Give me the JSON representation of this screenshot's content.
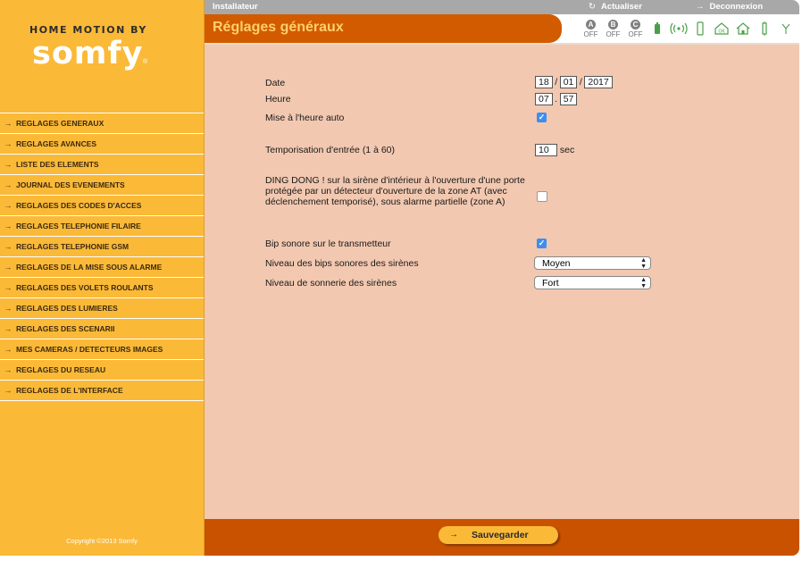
{
  "brand": {
    "tagline": "HOME MOTION BY",
    "name": "somfy",
    "mark": "®"
  },
  "sidebar": {
    "items": [
      {
        "label": "REGLAGES GENERAUX"
      },
      {
        "label": "REGLAGES AVANCES"
      },
      {
        "label": "LISTE DES ELEMENTS"
      },
      {
        "label": "JOURNAL DES EVENEMENTS"
      },
      {
        "label": "REGLAGES DES CODES D'ACCES"
      },
      {
        "label": "REGLAGES TELEPHONIE FILAIRE"
      },
      {
        "label": "REGLAGES TELEPHONIE GSM"
      },
      {
        "label": "REGLAGES DE LA MISE SOUS ALARME"
      },
      {
        "label": "REGLAGES DES VOLETS ROULANTS"
      },
      {
        "label": "REGLAGES DES LUMIERES"
      },
      {
        "label": "REGLAGES DES SCENARII"
      },
      {
        "label": "MES CAMERAS / DETECTEURS IMAGES"
      },
      {
        "label": "REGLAGES DU RESEAU"
      },
      {
        "label": "REGLAGES DE L'INTERFACE"
      }
    ],
    "copyright": "Copyright ©2013 Somfy"
  },
  "topbar": {
    "role": "Installateur",
    "refresh_label": "Actualiser",
    "logout_label": "Deconnexion"
  },
  "header": {
    "title": "Réglages généraux",
    "zones": [
      {
        "letter": "A",
        "state": "OFF"
      },
      {
        "letter": "B",
        "state": "OFF"
      },
      {
        "letter": "C",
        "state": "OFF"
      }
    ],
    "status_icons": [
      "battery-icon",
      "radio-signal-icon",
      "device-icon",
      "home-ok-icon",
      "house-icon",
      "sensor-icon",
      "antenna-icon"
    ],
    "accent_color": "#d25b00",
    "title_color": "#ffcf6a",
    "status_icon_color": "#4aa048"
  },
  "form": {
    "date": {
      "label": "Date",
      "day": "18",
      "month": "01",
      "year": "2017",
      "sep": "/"
    },
    "time": {
      "label": "Heure",
      "hours": "07",
      "minutes": "57",
      "sep": "."
    },
    "auto_time": {
      "label": "Mise à l'heure auto",
      "checked": true
    },
    "entry_delay": {
      "label": "Temporisation d'entrée (1 à 60)",
      "value": "10",
      "unit": "sec"
    },
    "ding_dong": {
      "label": "DING DONG ! sur la sirène d'intérieur à l'ouverture d'une porte protégée par un détecteur d'ouverture de la zone AT (avec déclenchement temporisé), sous alarme partielle (zone A)",
      "checked": false
    },
    "transmitter_beep": {
      "label": "Bip sonore sur le transmetteur",
      "checked": true
    },
    "siren_beep_level": {
      "label": "Niveau des bips sonores des sirènes",
      "value": "Moyen"
    },
    "siren_ring_level": {
      "label": "Niveau de sonnerie des sirènes",
      "value": "Fort"
    },
    "check_mark": "✓",
    "background_color": "#f2c8b0"
  },
  "footer": {
    "save_label": "Sauvegarder",
    "background_color": "#c95200"
  },
  "sidebar_color": "#fbb938"
}
